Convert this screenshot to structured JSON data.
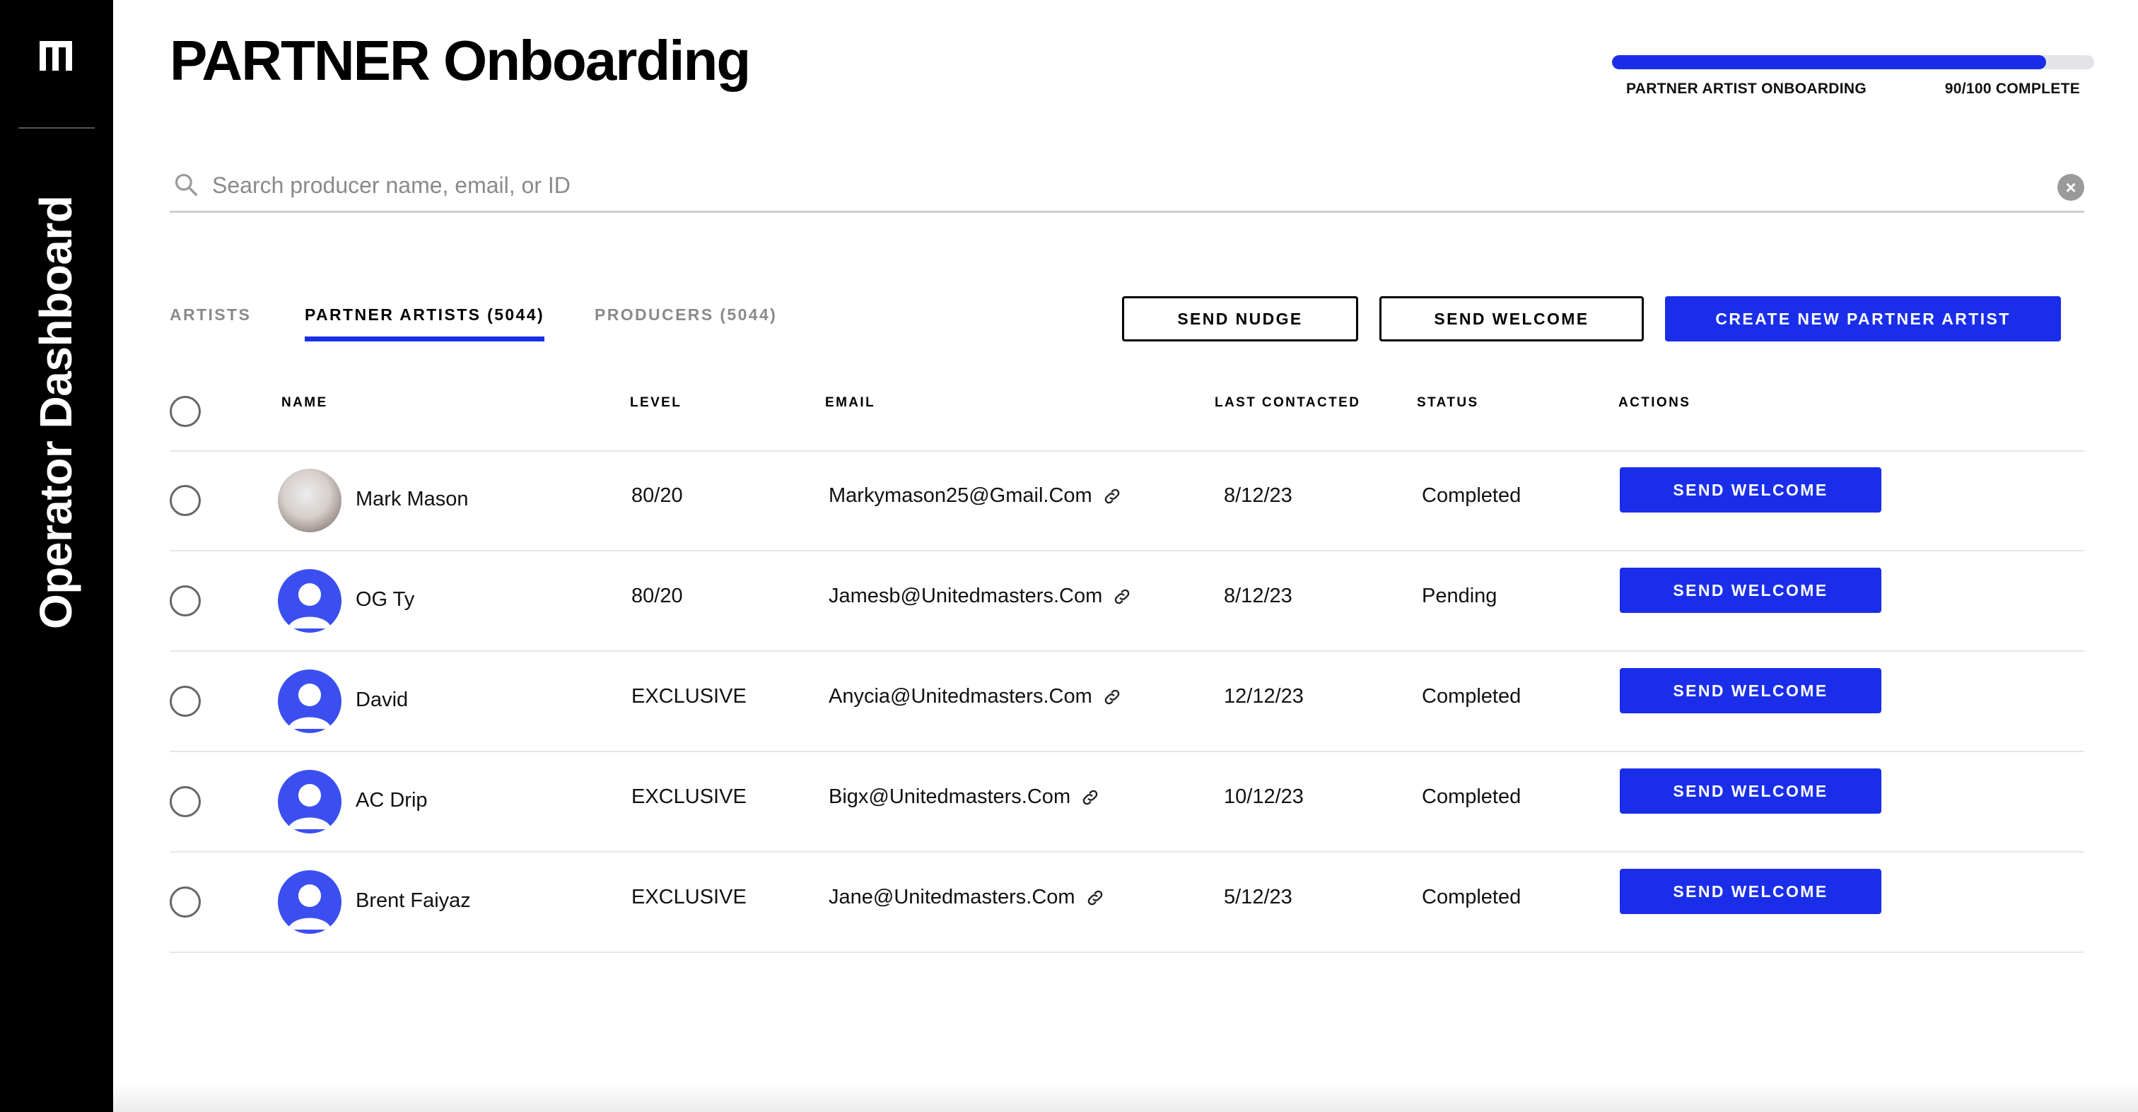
{
  "sidebar": {
    "title": "Operator Dashboard"
  },
  "page": {
    "title": "PARTNER Onboarding"
  },
  "progress": {
    "label": "PARTNER ARTIST ONBOARDING",
    "status": "90/100 COMPLETE",
    "fraction": 0.9
  },
  "search": {
    "placeholder": "Search producer name, email, or ID",
    "value": ""
  },
  "tabs": [
    {
      "label": "ARTISTS",
      "active": false
    },
    {
      "label": "PARTNER ARTISTS (5044)",
      "active": true
    },
    {
      "label": "PRODUCERS (5044)",
      "active": false
    }
  ],
  "toolbar": {
    "send_nudge": "SEND NUDGE",
    "send_welcome": "SEND WELCOME",
    "create_new": "CREATE NEW PARTNER ARTIST"
  },
  "table": {
    "headers": {
      "name": "NAME",
      "level": "LEVEL",
      "email": "EMAIL",
      "last_contacted": "LAST CONTACTED",
      "status": "STATUS",
      "actions": "ACTIONS"
    },
    "rows": [
      {
        "name": "Mark Mason",
        "avatar": "photo",
        "level": "80/20",
        "email": "Markymason25@Gmail.Com",
        "last_contacted": "8/12/23",
        "status": "Completed",
        "action": "SEND WELCOME"
      },
      {
        "name": "OG Ty",
        "avatar": "default",
        "level": "80/20",
        "email": "Jamesb@Unitedmasters.Com",
        "last_contacted": "8/12/23",
        "status": "Pending",
        "action": "SEND WELCOME"
      },
      {
        "name": "David",
        "avatar": "default",
        "level": "EXCLUSIVE",
        "email": "Anycia@Unitedmasters.Com",
        "last_contacted": "12/12/23",
        "status": "Completed",
        "action": "SEND WELCOME"
      },
      {
        "name": "AC Drip",
        "avatar": "default",
        "level": "EXCLUSIVE",
        "email": "Bigx@Unitedmasters.Com",
        "last_contacted": "10/12/23",
        "status": "Completed",
        "action": "SEND WELCOME"
      },
      {
        "name": "Brent Faiyaz",
        "avatar": "default",
        "level": "EXCLUSIVE",
        "email": "Jane@Unitedmasters.Com",
        "last_contacted": "5/12/23",
        "status": "Completed",
        "action": "SEND WELCOME"
      }
    ]
  },
  "colors": {
    "accent": "#1a2eea",
    "avatar_bg": "#3b4ff0",
    "sidebar_bg": "#000000"
  }
}
